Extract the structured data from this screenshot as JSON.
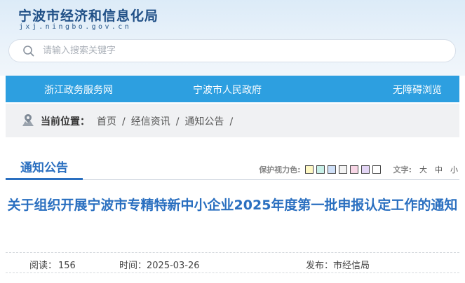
{
  "header": {
    "logo_cn": "宁波市经济和信息化局",
    "logo_en": "jxj.ningbo.gov.cn"
  },
  "search": {
    "placeholder": "请输入搜索关键字"
  },
  "nav": {
    "items": [
      "浙江政务服务网",
      "宁波市人民政府",
      "无障碍浏览"
    ]
  },
  "breadcrumb": {
    "label": "当前位置：",
    "items": [
      "首页",
      "经信资讯",
      "通知公告"
    ],
    "separator": "/"
  },
  "section": {
    "tab_label": "通知公告",
    "eye_label": "保护视力色:",
    "swatch_colors": [
      "#fff9c4",
      "#c8f0e8",
      "#cfe0f8",
      "#f3f3f3",
      "#f8d6e6",
      "#e3d5f5",
      "#ffffff"
    ],
    "font_label": "文字:",
    "font_sizes": [
      "大",
      "中",
      "小"
    ]
  },
  "article": {
    "title": "关于组织开展宁波市专精特新中小企业2025年度第一批申报认定工作的通知",
    "reads_label": "阅读：",
    "reads": "156",
    "time_label": "时间：",
    "time": "2025-03-26",
    "source_label": "发布：",
    "source": "市经信局"
  }
}
